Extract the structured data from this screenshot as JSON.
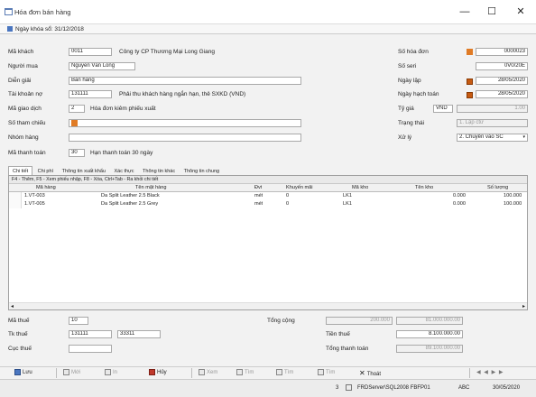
{
  "window": {
    "title": "Hóa đơn bán hàng",
    "minimize": "—",
    "maximize": "☐",
    "close": "✕"
  },
  "subbar": {
    "text": "Ngày khóa sổ: 31/12/2018"
  },
  "form": {
    "ma_khach_label": "Mã khách",
    "ma_khach": "0011",
    "ten_khach": "Công ty CP Thương Mại Long Giang",
    "nguoi_mua_label": "Người mua",
    "nguoi_mua": "Nguyễn Văn Long",
    "dien_giai_label": "Diễn giải",
    "dien_giai": "Bán hàng",
    "tk_no_label": "Tài khoản nợ",
    "tk_no": "131111",
    "tk_no_desc": "Phải thu khách hàng ngắn hạn, thẻ SXKD (VND)",
    "ma_giao_dich_label": "Mã giao dịch",
    "ma_giao_dich": "2",
    "ma_giao_dich_desc": "Hóa đơn kiêm phiếu xuất",
    "so_tham_chieu_label": "Số tham chiếu",
    "nhom_hang_label": "Nhóm hàng",
    "ma_thanh_toan_label": "Mã thanh toán",
    "ma_thanh_toan": "30",
    "ma_thanh_toan_desc": "Hạn thanh toán 30 ngày"
  },
  "right": {
    "so_hoa_don_label": "Số hóa đơn",
    "so_hoa_don": "0000023",
    "so_seri_label": "Số seri",
    "so_seri": "0V0/20E",
    "ngay_lap_label": "Ngày lập",
    "ngay_lap": "28/05/2020",
    "ngay_hach_toan_label": "Ngày hạch toán",
    "ngay_hach_toan": "28/05/2020",
    "ty_gia_label": "Tỷ giá",
    "ty_gia_code": "VND",
    "ty_gia": "1.00",
    "trang_thai_label": "Trạng thái",
    "trang_thai": "1. Lập ctừ",
    "xu_ly_label": "Xử lý",
    "xu_ly": "2. Chuyển vào SC"
  },
  "tabs": [
    "Chi tiết",
    "Chi phí",
    "Thông tin xuất khẩu",
    "Xác thực",
    "Thông tin khác",
    "Thông tin chung"
  ],
  "grid": {
    "hint": "F4 - Thêm, F5 - Xem phiếu nhập, F8 - Xóa, Ctrl+Tab - Ra khỏi chi tiết",
    "headers": [
      "Mã hàng",
      "Tên mặt hàng",
      "Đvt",
      "Khuyến mãi",
      "Mã kho",
      "Tên kho",
      "Số lượng"
    ],
    "rows": [
      [
        "1.VT-003",
        "Da Split Leather 2.5 Black",
        "mét",
        "0",
        "LK1",
        "0.000",
        "100.000"
      ],
      [
        "1.VT-005",
        "Da Split Leather 2.5 Grey",
        "mét",
        "0",
        "LK1",
        "0.000",
        "100.000"
      ]
    ]
  },
  "bottom": {
    "ma_thue_label": "Mã thuế",
    "ma_thue": "10",
    "tk_thue_label": "Tk thuế",
    "tk_thue": "131111",
    "tk_thue2": "33311",
    "cuc_thue_label": "Cục thuế",
    "tong_cong_label": "Tổng cộng",
    "tong_cong_sl": "200.000",
    "tong_cong_tien": "81.000.000.00",
    "tien_thue_label": "Tiền thuế",
    "tien_thue": "8.100.000.00",
    "tong_thanh_toan_label": "Tổng thanh toán",
    "tong_thanh_toan": "89.100.000.00"
  },
  "toolbar": {
    "luu": "Lưu",
    "moi": "Mới",
    "in": "In",
    "huy": "Hủy",
    "xem": "Xem",
    "tim": "Tìm",
    "tra": "Tìm",
    "thoat": "Thoát",
    "nav": "◀ ◀ ▶ ▶"
  },
  "status": {
    "count": "3",
    "server": "FRDServer\\SQL2008 FBFP01",
    "mode": "ABC",
    "date": "30/05/2020"
  },
  "colors": {
    "accent": "#c65a11",
    "calendar": "#e07b25"
  }
}
